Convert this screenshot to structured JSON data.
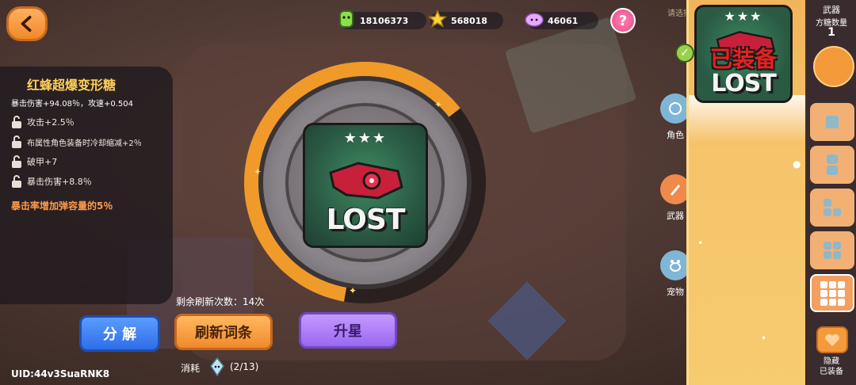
{
  "currencies": [
    {
      "name": "gem",
      "value": "18106373",
      "color": "#8be04a"
    },
    {
      "name": "star",
      "value": "568018",
      "color": "#ffd23a"
    },
    {
      "name": "cloud",
      "value": "46061",
      "color": "#e8a8ff"
    }
  ],
  "header": {
    "help_label": "?",
    "hint": "请选择方块"
  },
  "item": {
    "name": "红蜂超爆变形糖",
    "main_stats": "暴击伤害+94.08％，攻速+0.504",
    "sub_stats": [
      "攻击+2.5％",
      "布属性角色装备时冷却缩减+2％",
      "破甲+7",
      "暴击伤害+8.8％"
    ],
    "special": "暴击率增加弹容量的5％",
    "stars": "★★★",
    "card_text": "LOST"
  },
  "actions": {
    "refresh_remaining": "剩余刷新次数：14次",
    "decompose_label": "分 解",
    "refresh_label": "刷新词条",
    "star_up_label": "升星",
    "consume_label": "消耗",
    "consume_count": "(2/13)"
  },
  "uid": "UID:44v3SuaRNK8",
  "categories": [
    {
      "label": "角色",
      "color": "#7fb6d8"
    },
    {
      "label": "武器",
      "color": "#f08a4a"
    },
    {
      "label": "宠物",
      "color": "#7fb6d8"
    }
  ],
  "equipped": {
    "stars": "★★★",
    "badge": "已装备",
    "card_text": "LOST"
  },
  "right_bar": {
    "title": "武器",
    "subtitle": "方糖数量",
    "count": "1",
    "hide_label": "隐藏\n已装备"
  }
}
